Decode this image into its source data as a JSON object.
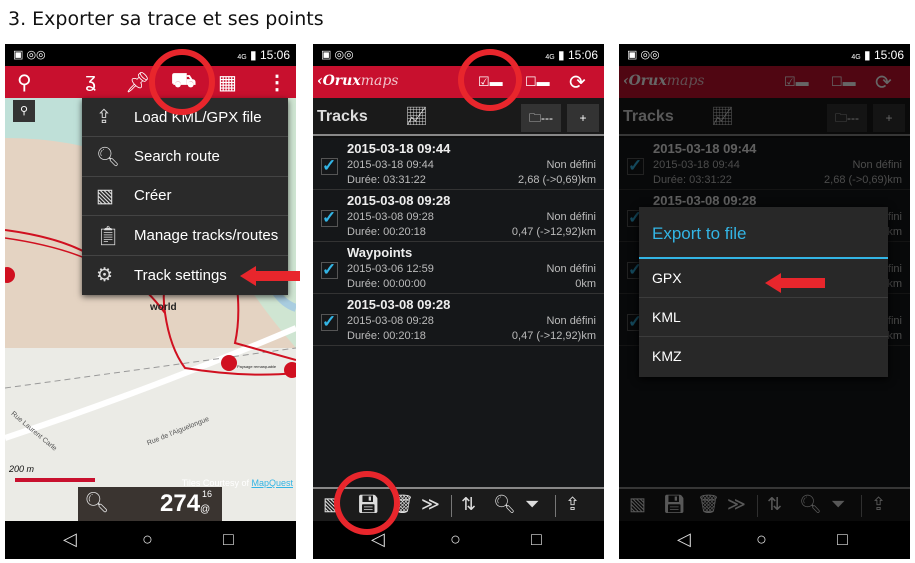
{
  "heading": "3. Exporter sa trace et ses points",
  "status": {
    "time": "15:06",
    "network": "4G"
  },
  "screen1": {
    "toolbar_icons": [
      "location-pin-icon",
      "route-icon",
      "pin-icon",
      "road-icon",
      "map-icon",
      "overflow-menu-icon"
    ],
    "menu": [
      {
        "label": "Load KML/GPX file",
        "icon": "upload-icon"
      },
      {
        "label": "Search route",
        "icon": "search-icon"
      },
      {
        "label": "Créer",
        "icon": "create-map-icon"
      },
      {
        "label": "Manage tracks/routes",
        "icon": "clipboard-icon"
      },
      {
        "label": "Track settings",
        "icon": "gear-icon"
      }
    ],
    "map_label": "world",
    "street1": "Rue de l'Aiguelongue",
    "street2": "Rue Laurent Carle",
    "poi_label": "Paysage remarquable",
    "scale": "200 m",
    "credit_prefix": "Tiles Courtesy of ",
    "credit_link": "MapQuest",
    "altitude": "274",
    "altitude_sup": "16",
    "altitude_sub": "@"
  },
  "app": {
    "logo_bold": "Orux",
    "logo_light": "maps"
  },
  "tracks_title": "Tracks",
  "folder_label": "---",
  "add_label": "+",
  "tracks": [
    {
      "name": "2015-03-18 09:44",
      "date": "2015-03-18 09:44",
      "duration": "Durée: 03:31:22",
      "type": "Non défini",
      "distance": "2,68 (->0,69)km"
    },
    {
      "name": "2015-03-08 09:28",
      "date": "2015-03-08 09:28",
      "duration": "Durée: 00:20:18",
      "type": "Non défini",
      "distance": "0,47 (->12,92)km"
    },
    {
      "name": "Waypoints",
      "date": "2015-03-06 12:59",
      "duration": "Durée: 00:00:00",
      "type": "Non défini",
      "distance": "0km"
    },
    {
      "name": "2015-03-08 09:28",
      "date": "2015-03-08 09:28",
      "duration": "Durée: 00:20:18",
      "type": "Non défini",
      "distance": "0,47 (->12,92)km"
    }
  ],
  "bottom_icons": [
    "map-icon",
    "save-icon",
    "trash-icon",
    "merge-icon",
    "sort-icon",
    "search-icon",
    "filter-icon",
    "upload-icon"
  ],
  "dialog": {
    "title": "Export to file",
    "options": [
      "GPX",
      "KML",
      "KMZ"
    ]
  },
  "colors": {
    "toolbar": "#c8102e",
    "accent": "#33b5e5",
    "annotation": "#e8262c"
  }
}
